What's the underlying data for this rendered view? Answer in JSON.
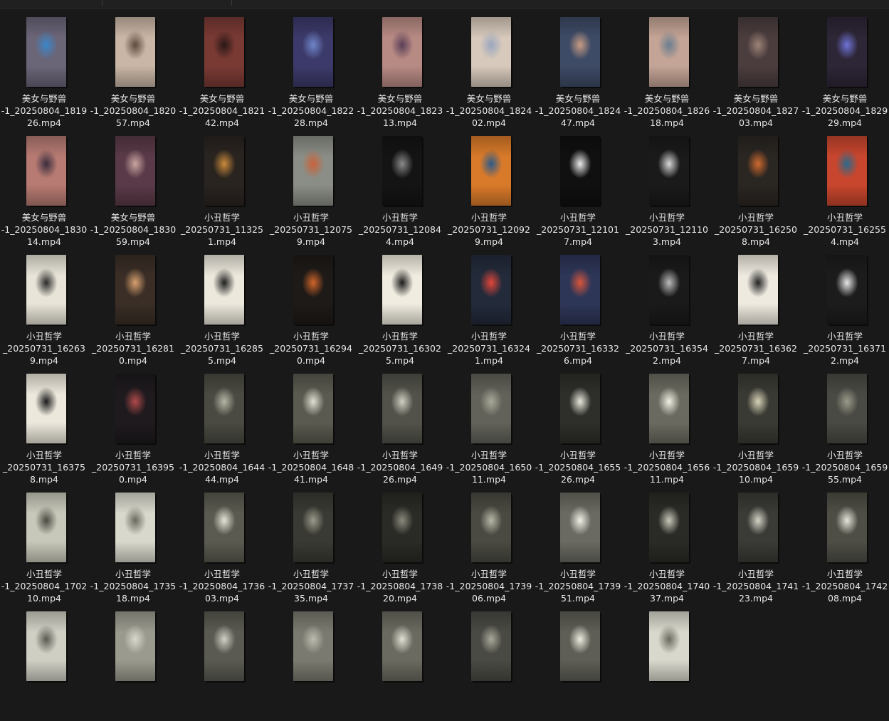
{
  "files": [
    {
      "l1": "美女与野兽",
      "l2": "-1_20250804_1819",
      "l3": "26.mp4",
      "bg": "#6b6578",
      "fg": "#3b86c9"
    },
    {
      "l1": "美女与野兽",
      "l2": "-1_20250804_1820",
      "l3": "57.mp4",
      "bg": "#c9b6a6",
      "fg": "#5e4a3e"
    },
    {
      "l1": "美女与野兽",
      "l2": "-1_20250804_1821",
      "l3": "42.mp4",
      "bg": "#7a3a34",
      "fg": "#2a1816"
    },
    {
      "l1": "美女与野兽",
      "l2": "-1_20250804_1822",
      "l3": "28.mp4",
      "bg": "#3c3a6a",
      "fg": "#6f86c9"
    },
    {
      "l1": "美女与野兽",
      "l2": "-1_20250804_1823",
      "l3": "13.mp4",
      "bg": "#b88a84",
      "fg": "#5a3f57"
    },
    {
      "l1": "美女与野兽",
      "l2": "-1_20250804_1824",
      "l3": "02.mp4",
      "bg": "#d7c9bb",
      "fg": "#9aa6bf"
    },
    {
      "l1": "美女与野兽",
      "l2": "-1_20250804_1824",
      "l3": "47.mp4",
      "bg": "#3e4b66",
      "fg": "#c79b82"
    },
    {
      "l1": "美女与野兽",
      "l2": "-1_20250804_1826",
      "l3": "18.mp4",
      "bg": "#c4a496",
      "fg": "#6a7d8f"
    },
    {
      "l1": "美女与野兽",
      "l2": "-1_20250804_1827",
      "l3": "03.mp4",
      "bg": "#4b3d3e",
      "fg": "#9c8276"
    },
    {
      "l1": "美女与野兽",
      "l2": "-1_20250804_1829",
      "l3": "29.mp4",
      "bg": "#2d2636",
      "fg": "#6f72d6"
    },
    {
      "l1": "美女与野兽",
      "l2": "-1_20250804_1830",
      "l3": "14.mp4",
      "bg": "#b77b73",
      "fg": "#3a2d3d"
    },
    {
      "l1": "美女与野兽",
      "l2": "-1_20250804_1830",
      "l3": "59.mp4",
      "bg": "#5a3a48",
      "fg": "#c9a4a0"
    },
    {
      "l1": "小丑哲学",
      "l2": "_20250731_11325",
      "l3": "1.mp4",
      "bg": "#2a2420",
      "fg": "#c98a3a"
    },
    {
      "l1": "小丑哲学",
      "l2": "_20250731_12075",
      "l3": "9.mp4",
      "bg": "#8b8e86",
      "fg": "#c9623a"
    },
    {
      "l1": "小丑哲学",
      "l2": "_20250731_12084",
      "l3": "4.mp4",
      "bg": "#141414",
      "fg": "#8a8a8a"
    },
    {
      "l1": "小丑哲学",
      "l2": "_20250731_12092",
      "l3": "9.mp4",
      "bg": "#d97a2a",
      "fg": "#2c5a8a"
    },
    {
      "l1": "小丑哲学",
      "l2": "_20250731_12101",
      "l3": "7.mp4",
      "bg": "#101010",
      "fg": "#eaeaea"
    },
    {
      "l1": "小丑哲学",
      "l2": "_20250731_12110",
      "l3": "3.mp4",
      "bg": "#1a1a1a",
      "fg": "#d8d8d8"
    },
    {
      "l1": "小丑哲学",
      "l2": "_20250731_16250",
      "l3": "8.mp4",
      "bg": "#2a2622",
      "fg": "#d06a2e"
    },
    {
      "l1": "小丑哲学",
      "l2": "_20250731_16255",
      "l3": "4.mp4",
      "bg": "#c8462e",
      "fg": "#2a6a8a"
    },
    {
      "l1": "小丑哲学",
      "l2": "_20250731_16263",
      "l3": "9.mp4",
      "bg": "#e8e4d8",
      "fg": "#2a2a2a"
    },
    {
      "l1": "小丑哲学",
      "l2": "_20250731_16281",
      "l3": "0.mp4",
      "bg": "#3a2e26",
      "fg": "#d8a070"
    },
    {
      "l1": "小丑哲学",
      "l2": "_20250731_16285",
      "l3": "5.mp4",
      "bg": "#ece8dc",
      "fg": "#1e1e1e"
    },
    {
      "l1": "小丑哲学",
      "l2": "_20250731_16294",
      "l3": "0.mp4",
      "bg": "#1e1a18",
      "fg": "#d0652a"
    },
    {
      "l1": "小丑哲学",
      "l2": "_20250731_16302",
      "l3": "5.mp4",
      "bg": "#f0ece0",
      "fg": "#1a1a1a"
    },
    {
      "l1": "小丑哲学",
      "l2": "_20250731_16324",
      "l3": "1.mp4",
      "bg": "#232a3a",
      "fg": "#e2463a"
    },
    {
      "l1": "小丑哲学",
      "l2": "_20250731_16332",
      "l3": "6.mp4",
      "bg": "#2e3658",
      "fg": "#d8553a"
    },
    {
      "l1": "小丑哲学",
      "l2": "_20250731_16354",
      "l3": "2.mp4",
      "bg": "#1a1a1a",
      "fg": "#bcbcbc"
    },
    {
      "l1": "小丑哲学",
      "l2": "_20250731_16362",
      "l3": "7.mp4",
      "bg": "#eeeae0",
      "fg": "#222222"
    },
    {
      "l1": "小丑哲学",
      "l2": "_20250731_16371",
      "l3": "2.mp4",
      "bg": "#1c1c1c",
      "fg": "#e8e8e8"
    },
    {
      "l1": "小丑哲学",
      "l2": "_20250731_16375",
      "l3": "8.mp4",
      "bg": "#ece8dc",
      "fg": "#1a1a1a"
    },
    {
      "l1": "小丑哲学",
      "l2": "_20250731_16395",
      "l3": "0.mp4",
      "bg": "#1e1a1e",
      "fg": "#b04a4a"
    },
    {
      "l1": "小丑哲学",
      "l2": "-1_20250804_1644",
      "l3": "44.mp4",
      "bg": "#4a4a42",
      "fg": "#b6b6a6"
    },
    {
      "l1": "小丑哲学",
      "l2": "-1_20250804_1648",
      "l3": "41.mp4",
      "bg": "#5a5a50",
      "fg": "#e0e0d4"
    },
    {
      "l1": "小丑哲学",
      "l2": "-1_20250804_1649",
      "l3": "26.mp4",
      "bg": "#52524a",
      "fg": "#cfcfc2"
    },
    {
      "l1": "小丑哲学",
      "l2": "-1_20250804_1650",
      "l3": "11.mp4",
      "bg": "#62625a",
      "fg": "#a8a898"
    },
    {
      "l1": "小丑哲学",
      "l2": "-1_20250804_1655",
      "l3": "26.mp4",
      "bg": "#2e2e2a",
      "fg": "#e8e8dc"
    },
    {
      "l1": "小丑哲学",
      "l2": "-1_20250804_1656",
      "l3": "11.mp4",
      "bg": "#6a6a60",
      "fg": "#f0f0e4"
    },
    {
      "l1": "小丑哲学",
      "l2": "-1_20250804_1659",
      "l3": "10.mp4",
      "bg": "#3a3a34",
      "fg": "#d8d4b8"
    },
    {
      "l1": "小丑哲学",
      "l2": "-1_20250804_1659",
      "l3": "55.mp4",
      "bg": "#4a4a44",
      "fg": "#9a9a8a"
    },
    {
      "l1": "小丑哲学",
      "l2": "-1_20250804_1702",
      "l3": "10.mp4",
      "bg": "#c8c8ba",
      "fg": "#4a4a42"
    },
    {
      "l1": "小丑哲学",
      "l2": "-1_20250804_1735",
      "l3": "18.mp4",
      "bg": "#d8d8cc",
      "fg": "#6a6a60"
    },
    {
      "l1": "小丑哲学",
      "l2": "-1_20250804_1736",
      "l3": "03.mp4",
      "bg": "#5a5a50",
      "fg": "#e4e4d8"
    },
    {
      "l1": "小丑哲学",
      "l2": "-1_20250804_1737",
      "l3": "35.mp4",
      "bg": "#3a3a34",
      "fg": "#9a9a8c"
    },
    {
      "l1": "小丑哲学",
      "l2": "-1_20250804_1738",
      "l3": "20.mp4",
      "bg": "#2a2a26",
      "fg": "#8a8a7c"
    },
    {
      "l1": "小丑哲学",
      "l2": "-1_20250804_1739",
      "l3": "06.mp4",
      "bg": "#4a4a42",
      "fg": "#b8b8a8"
    },
    {
      "l1": "小丑哲学",
      "l2": "-1_20250804_1739",
      "l3": "51.mp4",
      "bg": "#6a6a62",
      "fg": "#f0f0e6"
    },
    {
      "l1": "小丑哲学",
      "l2": "-1_20250804_1740",
      "l3": "37.mp4",
      "bg": "#2a2a26",
      "fg": "#c8c8ba"
    },
    {
      "l1": "小丑哲学",
      "l2": "-1_20250804_1741",
      "l3": "23.mp4",
      "bg": "#3a3a36",
      "fg": "#d4d4c6"
    },
    {
      "l1": "小丑哲学",
      "l2": "-1_20250804_1742",
      "l3": "08.mp4",
      "bg": "#4e4e46",
      "fg": "#e6e6da"
    },
    {
      "l1": "",
      "l2": "",
      "l3": "",
      "bg": "#cfcfc4",
      "fg": "#5a5a52"
    },
    {
      "l1": "",
      "l2": "",
      "l3": "",
      "bg": "#9a9a8e",
      "fg": "#d8d8cc"
    },
    {
      "l1": "",
      "l2": "",
      "l3": "",
      "bg": "#5a5a52",
      "fg": "#d0d0c4"
    },
    {
      "l1": "",
      "l2": "",
      "l3": "",
      "bg": "#7a7a70",
      "fg": "#bcbcae"
    },
    {
      "l1": "",
      "l2": "",
      "l3": "",
      "bg": "#6a6a60",
      "fg": "#e0e0d4"
    },
    {
      "l1": "",
      "l2": "",
      "l3": "",
      "bg": "#4a4a44",
      "fg": "#a8a89a"
    },
    {
      "l1": "",
      "l2": "",
      "l3": "",
      "bg": "#5e5e56",
      "fg": "#ececE0"
    },
    {
      "l1": "",
      "l2": "",
      "l3": "",
      "bg": "#d8d8cc",
      "fg": "#6a6a60"
    }
  ]
}
